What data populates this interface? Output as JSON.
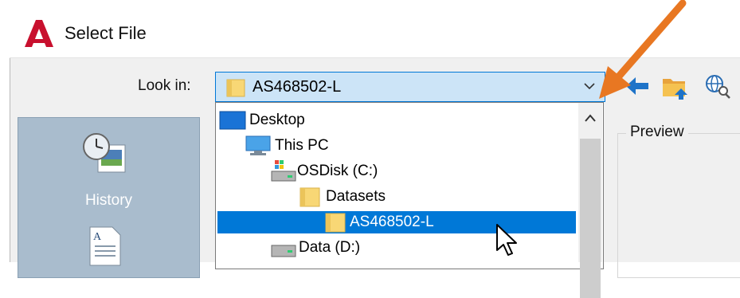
{
  "window": {
    "title": "Select File"
  },
  "toolbar": {
    "lookin_label": "Look in:",
    "lookin_value": "AS468502-L",
    "icons": [
      "back-arrow-icon",
      "up-folder-icon",
      "search-web-icon"
    ]
  },
  "places": {
    "history_label": "History"
  },
  "dropdown": {
    "items": [
      {
        "label": "Desktop",
        "icon": "desktop-icon",
        "selected": false
      },
      {
        "label": "This PC",
        "icon": "computer-icon",
        "selected": false
      },
      {
        "label": "OSDisk (C:)",
        "icon": "system-drive-icon",
        "selected": false
      },
      {
        "label": "Datasets",
        "icon": "folder-icon",
        "selected": false
      },
      {
        "label": "AS468502-L",
        "icon": "folder-icon",
        "selected": true
      },
      {
        "label": "Data (D:)",
        "icon": "drive-icon",
        "selected": false
      }
    ]
  },
  "preview": {
    "label": "Preview"
  },
  "colors": {
    "accent": "#0078d7",
    "annotation_arrow": "#e87722",
    "autocad_red": "#c8102e",
    "folder_yellow": "#f8d775"
  }
}
